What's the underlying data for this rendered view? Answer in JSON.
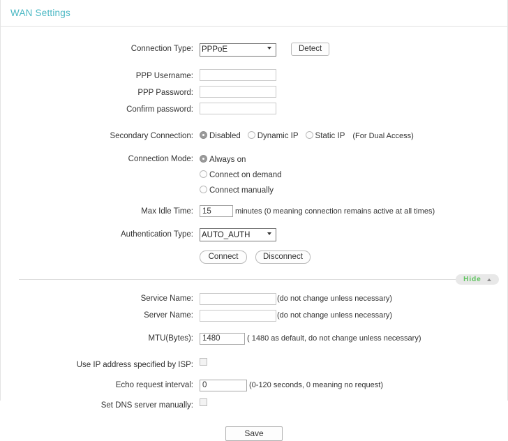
{
  "header": {
    "title": "WAN Settings"
  },
  "form": {
    "connection_type": {
      "label": "Connection Type:",
      "value": "PPPoE",
      "options": [
        "PPPoE"
      ],
      "detect_button": "Detect"
    },
    "ppp_username": {
      "label": "PPP Username:",
      "value": ""
    },
    "ppp_password": {
      "label": "PPP Password:",
      "value": ""
    },
    "confirm_password": {
      "label": "Confirm password:",
      "value": ""
    },
    "secondary_connection": {
      "label": "Secondary Connection:",
      "options": [
        {
          "label": "Disabled",
          "selected": true
        },
        {
          "label": "Dynamic IP",
          "selected": false
        },
        {
          "label": "Static IP",
          "selected": false
        }
      ],
      "note": "(For Dual Access)"
    },
    "connection_mode": {
      "label": "Connection Mode:",
      "options": [
        {
          "label": "Always on",
          "selected": true
        },
        {
          "label": "Connect on demand",
          "selected": false
        },
        {
          "label": "Connect manually",
          "selected": false
        }
      ]
    },
    "max_idle_time": {
      "label": "Max Idle Time:",
      "value": "15",
      "hint": "minutes (0 meaning connection remains active at all times)"
    },
    "authentication_type": {
      "label": "Authentication Type:",
      "value": "AUTO_AUTH",
      "options": [
        "AUTO_AUTH"
      ]
    },
    "connect_button": "Connect",
    "disconnect_button": "Disconnect",
    "hide_toggle": {
      "label": "Hide",
      "icon": "chevron-up-icon"
    },
    "service_name": {
      "label": "Service Name:",
      "value": "",
      "hint": "(do not change unless necessary)"
    },
    "server_name": {
      "label": "Server Name:",
      "value": "",
      "hint": "(do not change unless necessary)"
    },
    "mtu": {
      "label": "MTU(Bytes):",
      "value": "1480",
      "hint": "( 1480 as default, do not change unless necessary)"
    },
    "use_isp_ip": {
      "label": "Use IP address specified by ISP:",
      "checked": false
    },
    "echo_request": {
      "label": "Echo request interval:",
      "value": "0",
      "hint": "(0-120 seconds, 0 meaning no request)"
    },
    "set_dns_manually": {
      "label": "Set DNS server manually:",
      "checked": false
    },
    "save_button": "Save"
  }
}
